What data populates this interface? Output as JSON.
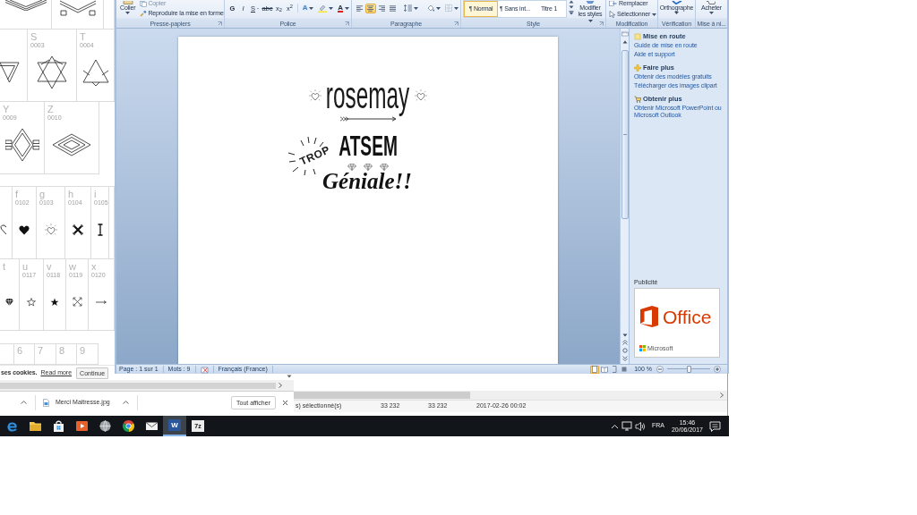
{
  "character_map": {
    "rows": [
      [
        {},
        {},
        {}
      ],
      [
        {},
        {
          "char": "S",
          "code": "0003"
        },
        {
          "char": "T",
          "code": "0004"
        }
      ],
      [
        {
          "char": "Y",
          "code": "0009"
        },
        {
          "char": "Z",
          "code": "0010"
        }
      ],
      [
        {},
        {
          "char": "f",
          "code": "0102"
        },
        {
          "char": "g",
          "code": "0103"
        },
        {
          "char": "h",
          "code": "0104"
        },
        {
          "char": "i",
          "code": "0105"
        },
        {}
      ],
      [
        {
          "char": "t"
        },
        {
          "char": "u",
          "code": "0117"
        },
        {
          "char": "v",
          "code": "0118"
        },
        {
          "char": "w",
          "code": "0119"
        },
        {
          "char": "x",
          "code": "0120"
        }
      ],
      [
        {},
        {
          "char": "6"
        },
        {
          "char": "7"
        },
        {
          "char": "8"
        },
        {
          "char": "9"
        }
      ]
    ]
  },
  "cookie_notice": {
    "text": "ses cookies.",
    "link": "Read more",
    "button": "Continue"
  },
  "downloads_bar": {
    "files": [
      {
        "name": "Merci Maitresse.jpg"
      }
    ],
    "show_all": "Tout afficher"
  },
  "explorer_window": {
    "status_cells": [
      "s) sélectionné(s)",
      "33 232",
      "33 232",
      "2017-02-26 00:02"
    ]
  },
  "word": {
    "ribbon": {
      "clipboard": {
        "paste": "Coller",
        "copy": {
          "label": "Copier",
          "disabled": true
        },
        "format_painter": "Reproduire la mise en forme",
        "label": "Presse-papiers"
      },
      "font": {
        "buttons": [
          {
            "label": "G",
            "kind": "bold"
          },
          {
            "label": "I",
            "kind": "italic"
          },
          {
            "label": "S",
            "kind": "underline"
          },
          {
            "label": "abc",
            "kind": "strike"
          },
          {
            "label": "x$_{2}$",
            "kind": "subscript"
          },
          {
            "label": "x$^{2}$",
            "kind": "superscript"
          }
        ],
        "text_effects": "A",
        "font_color": "A",
        "label": "Police"
      },
      "paragraph": {
        "alignments": [
          {
            "selected": false
          },
          {
            "selected": true
          },
          {
            "selected": false
          },
          {
            "selected": false
          }
        ],
        "label": "Paragraphe"
      },
      "styles": {
        "items": [
          {
            "name": "¶ Normal",
            "selected": true
          },
          {
            "name": "¶ Sans int...",
            "selected": false
          },
          {
            "name": "Titre 1",
            "selected": false
          }
        ],
        "modify": "Modifier les styles",
        "label": "Style"
      },
      "editing": {
        "replace": "Remplacer",
        "select": "Sélectionner",
        "label": "Modification"
      },
      "proofing": {
        "spelling": "Orthographe",
        "label": "Vérification"
      },
      "upgrade": {
        "buy": "Acheter",
        "label": "Mise à ni..."
      }
    },
    "document": {
      "name": "rosemay",
      "badge": "TROP",
      "headline": "ATSEM",
      "tagline": "Géniale!!"
    },
    "task_pane": {
      "sections": [
        {
          "title": "Mise en route",
          "links": [
            "Guide de mise en route",
            "Aide et support"
          ]
        },
        {
          "title": "Faire plus",
          "links": [
            "Obtenir des modèles gratuits",
            "Télécharger des images clipart"
          ]
        },
        {
          "title": "Obtenir plus",
          "links": [
            "Obtenir Microsoft PowerPoint ou Microsoft Outlook"
          ]
        }
      ],
      "ad_label": "Publicité",
      "ad": {
        "product": "Office",
        "brand": "Microsoft"
      }
    },
    "status_bar": {
      "page": "Page : 1 sur 1",
      "words": "Mots : 9",
      "language": "Français (France)",
      "views": [
        {
          "selected": true
        },
        {
          "selected": false
        },
        {
          "selected": false
        },
        {
          "selected": false
        }
      ],
      "zoom": "100 %",
      "zoom_slider": {
        "level": 0.5
      }
    }
  },
  "taskbar": {
    "apps": [
      {
        "selected": false
      },
      {
        "selected": false
      },
      {
        "selected": false
      },
      {
        "selected": false
      },
      {
        "selected": false
      },
      {
        "selected": false
      },
      {
        "selected": false
      },
      {
        "selected": true,
        "badge": "W"
      },
      {
        "selected": false,
        "badge": "7z"
      }
    ],
    "tray": {
      "language": "FRA",
      "time": "15:46",
      "date": "20/06/2017"
    }
  }
}
